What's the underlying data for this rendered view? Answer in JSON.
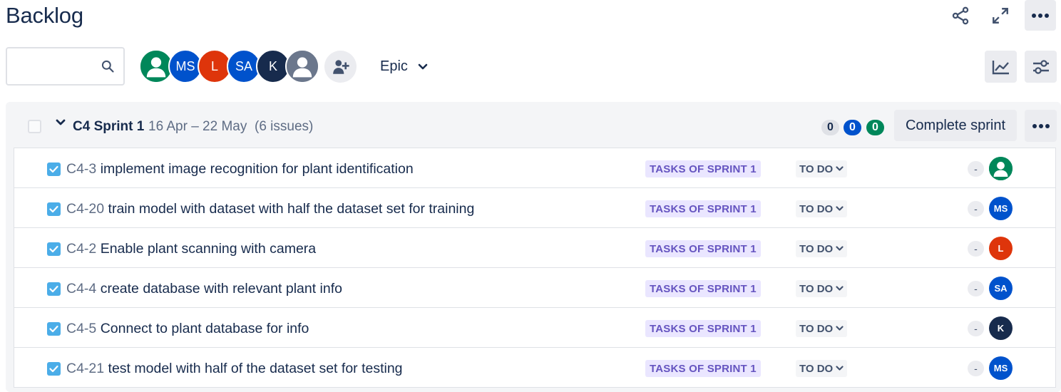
{
  "page": {
    "title": "Backlog"
  },
  "header_actions": {
    "share_icon": "share-icon",
    "fullscreen_icon": "expand-icon",
    "more_icon": "more-icon"
  },
  "toolbar": {
    "search": {
      "value": "",
      "placeholder": "",
      "icon": "search-icon"
    },
    "avatars": [
      {
        "initials": "",
        "color": "#00875a",
        "kind": "default-person"
      },
      {
        "initials": "MS",
        "color": "#0052cc"
      },
      {
        "initials": "L",
        "color": "#de350b"
      },
      {
        "initials": "SA",
        "color": "#0052cc"
      },
      {
        "initials": "K",
        "color": "#172b4d"
      },
      {
        "initials": "",
        "color": "#6b778c",
        "kind": "default-person"
      }
    ],
    "add_people_icon": "add-person-icon",
    "epic_filter": {
      "label": "Epic",
      "icon": "chevron-down-icon"
    },
    "insights_icon": "insights-icon",
    "view_settings_icon": "view-settings-icon"
  },
  "sprint": {
    "name": "C4 Sprint 1",
    "dates": "16 Apr – 22 May",
    "issue_count": "(6 issues)",
    "counts": {
      "todo": "0",
      "in_progress": "0",
      "done": "0"
    },
    "complete_label": "Complete sprint",
    "issues": [
      {
        "key": "C4-3",
        "summary": "implement image recognition for plant identification",
        "epic": "TASKS OF SPRINT 1",
        "status": "TO DO",
        "estimate": "-",
        "assignee": {
          "initials": "",
          "color": "#00875a",
          "kind": "default-person"
        }
      },
      {
        "key": "C4-20",
        "summary": "train model with dataset with half the dataset set for training",
        "epic": "TASKS OF SPRINT 1",
        "status": "TO DO",
        "estimate": "-",
        "assignee": {
          "initials": "MS",
          "color": "#0052cc"
        }
      },
      {
        "key": "C4-2",
        "summary": "Enable plant scanning with camera",
        "epic": "TASKS OF SPRINT 1",
        "status": "TO DO",
        "estimate": "-",
        "assignee": {
          "initials": "L",
          "color": "#de350b"
        }
      },
      {
        "key": "C4-4",
        "summary": "create database with relevant plant info",
        "epic": "TASKS OF SPRINT 1",
        "status": "TO DO",
        "estimate": "-",
        "assignee": {
          "initials": "SA",
          "color": "#0052cc"
        }
      },
      {
        "key": "C4-5",
        "summary": "Connect to plant database for info",
        "epic": "TASKS OF SPRINT 1",
        "status": "TO DO",
        "estimate": "-",
        "assignee": {
          "initials": "K",
          "color": "#172b4d"
        }
      },
      {
        "key": "C4-21",
        "summary": "test model with half of the dataset set for testing",
        "epic": "TASKS OF SPRINT 1",
        "status": "TO DO",
        "estimate": "-",
        "assignee": {
          "initials": "MS",
          "color": "#0052cc"
        }
      }
    ]
  }
}
